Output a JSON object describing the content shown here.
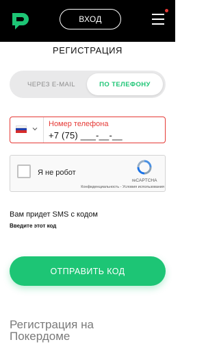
{
  "header": {
    "login_label": "ВХОД",
    "logo_icon": "pokerdom-logo-icon",
    "menu_icon": "hamburger-menu-icon",
    "brand_color": "#1dc575",
    "notification_color": "#e53935"
  },
  "page": {
    "title": "РЕГИСТРАЦИЯ"
  },
  "method_switch": {
    "email_label": "ЧЕРЕЗ E-MAIL",
    "phone_label": "ПО ТЕЛЕФОНУ",
    "selected": "ПО ТЕЛЕФОНУ"
  },
  "phone_field": {
    "label": "Номер телефона",
    "value": "+7 (75) ___-__-__",
    "country_flag": "russia-flag-icon",
    "error_color": "#e53935"
  },
  "captcha": {
    "label": "Я не робот",
    "brand": "reCAPTCHA",
    "links": "Конфиденциальность - Условия использования"
  },
  "sms": {
    "notice": "Вам придет SMS с кодом",
    "enter_code": "Введите этот код"
  },
  "send_button": {
    "label": "ОТПРАВИТЬ КОД"
  },
  "footer": {
    "heading": "Регистрация на Покердоме"
  }
}
